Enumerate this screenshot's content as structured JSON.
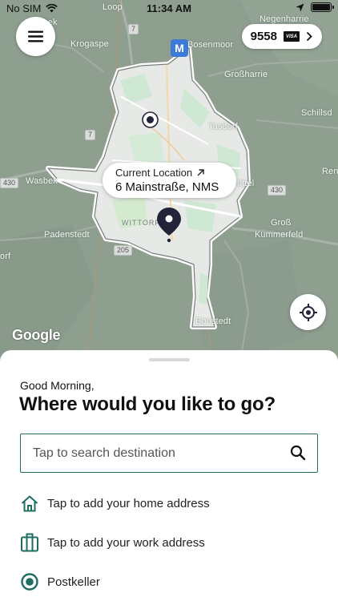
{
  "status_bar": {
    "carrier": "No SIM",
    "time": "11:34 AM"
  },
  "map": {
    "labels": {
      "tarbek": "Tarbek",
      "loop": "Loop",
      "negenharrie": "Negenharrie",
      "krogaspe": "Krogaspe",
      "bosenmoor": "Bosenmoor",
      "grossharrie": "Großharrie",
      "schillsdorf": "Schillsd",
      "tasdorf": "Tasdorf",
      "wasbek": "Wasbek",
      "ruettel": "üttel",
      "ren": "Ren",
      "wittorf": "WITTORF",
      "padenstedt": "Padenstedt",
      "gross_kummerfeld_1": "Groß",
      "gross_kummerfeld_2": "Kummerfeld",
      "orf": "orf",
      "boostedt": "Boostedt"
    },
    "road_numbers": {
      "r7a": "7",
      "r7b": "7",
      "r430a": "430",
      "r430b": "430",
      "r205": "205"
    },
    "metro_label": "M",
    "google_logo": "Google"
  },
  "payment": {
    "card_number": "9558",
    "card_brand": "VISA"
  },
  "current_location": {
    "label": "Current Location",
    "address": "6 Mainstraße, NMS"
  },
  "sheet": {
    "greeting": "Good Morning,",
    "question": "Where would you like to go?",
    "search_placeholder": "Tap to search destination",
    "options": [
      {
        "icon": "home-icon",
        "label": "Tap to add your home address"
      },
      {
        "icon": "briefcase-icon",
        "label": "Tap to add your work address"
      },
      {
        "icon": "target-icon",
        "label": "Postkeller"
      }
    ]
  },
  "colors": {
    "accent": "#1e6f62",
    "pin": "#23233a",
    "map_base": "#8a9b8c",
    "city_area": "#e8ebe8"
  }
}
